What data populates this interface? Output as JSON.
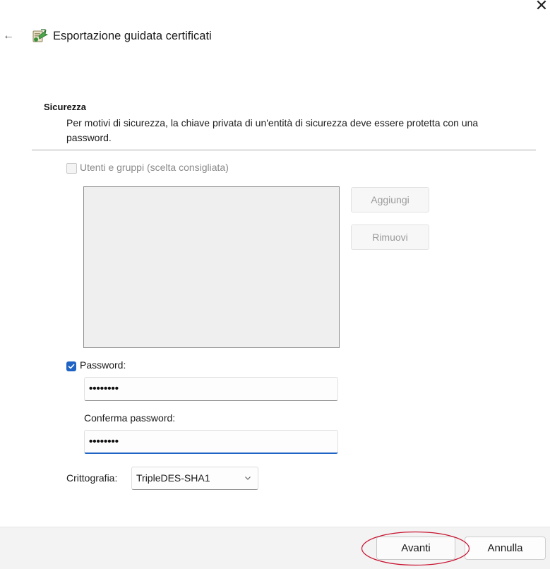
{
  "window": {
    "title": "Esportazione guidata certificati",
    "close_glyph": "✕",
    "back_glyph": "←",
    "icons": {
      "close": "close-icon",
      "back": "back-arrow-icon",
      "wizard": "certificate-wizard-icon"
    }
  },
  "section": {
    "title": "Sicurezza",
    "description": "Per motivi di sicurezza, la chiave privata di un'entità di sicurezza deve essere protetta con una password."
  },
  "users_groups": {
    "label": "Utenti e gruppi (scelta consigliata)",
    "checked": false,
    "enabled": false,
    "add_label": "Aggiungi",
    "remove_label": "Rimuovi"
  },
  "password": {
    "label": "Password:",
    "checked": true,
    "value": "••••••••",
    "confirm_label": "Conferma password:",
    "confirm_value": "••••••••"
  },
  "encryption": {
    "label": "Crittografia:",
    "selected": "TripleDES-SHA1"
  },
  "footer": {
    "next_label": "Avanti",
    "cancel_label": "Annulla"
  },
  "colors": {
    "accent": "#1f63c4",
    "highlight_ring": "#c8102e",
    "footer_bg": "#f3f3f3",
    "disabled_text": "#9a9a9a"
  }
}
